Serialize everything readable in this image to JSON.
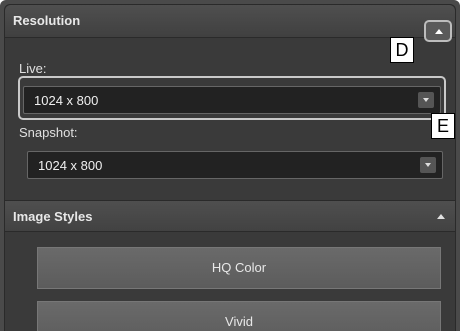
{
  "resolution_panel": {
    "title": "Resolution",
    "live": {
      "label": "Live:",
      "value": "1024 x 800"
    },
    "snapshot": {
      "label": "Snapshot:",
      "value": "1024 x 800"
    }
  },
  "image_styles_panel": {
    "title": "Image Styles",
    "buttons": [
      "HQ Color",
      "Vivid"
    ]
  },
  "callouts": {
    "d": "D",
    "e": "E"
  },
  "icons": {
    "collapse": "triangle-up-icon",
    "dropdown": "chevron-down-icon"
  }
}
